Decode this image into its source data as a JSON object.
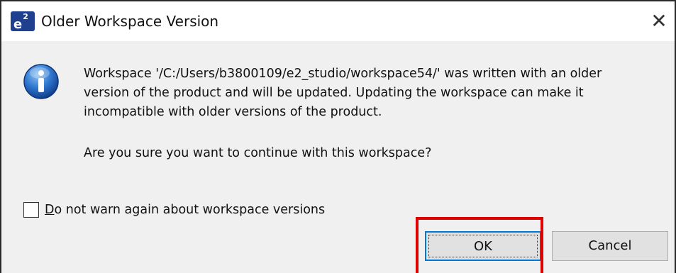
{
  "window": {
    "title": "Older Workspace Version",
    "app_icon_label": "e",
    "app_icon_sup": "2",
    "close_glyph": "✕"
  },
  "message": {
    "lines": [
      "Workspace '/C:/Users/b3800109/e2_studio/workspace54/' was written with an older",
      "version of the product and will be updated. Updating the workspace can make it",
      "incompatible with older versions of the product."
    ],
    "question": "Are you sure you want to continue with this workspace?"
  },
  "checkbox": {
    "mnemonic": "D",
    "label_rest": "o not warn again about workspace versions",
    "checked": false
  },
  "buttons": {
    "ok_label": "OK",
    "cancel_label": "Cancel"
  },
  "colors": {
    "highlight": "#e00000",
    "focus_border": "#0078d7",
    "info_icon": "#1e5fb3"
  },
  "icons": {
    "info": "info-icon",
    "close": "close-icon",
    "app": "e2-studio-logo-icon"
  }
}
